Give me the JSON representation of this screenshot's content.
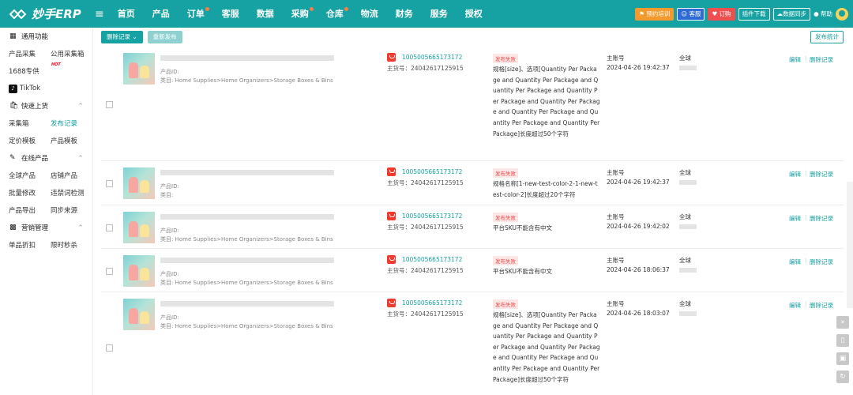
{
  "header": {
    "logo": "妙手ERP",
    "nav": [
      {
        "label": "首页",
        "dot": false
      },
      {
        "label": "产品",
        "dot": false
      },
      {
        "label": "订单",
        "dot": true
      },
      {
        "label": "客服",
        "dot": false
      },
      {
        "label": "数据",
        "dot": false
      },
      {
        "label": "采购",
        "dot": true
      },
      {
        "label": "仓库",
        "dot": true
      },
      {
        "label": "物流",
        "dot": false
      },
      {
        "label": "财务",
        "dot": false
      },
      {
        "label": "服务",
        "dot": false
      },
      {
        "label": "授权",
        "dot": false
      }
    ],
    "training": "预约培训",
    "service": "客服",
    "order_btn": "订购",
    "plugin_download": "插件下载",
    "data_sync": "数据同步",
    "help": "帮助"
  },
  "sidebar": {
    "common_title": "通用功能",
    "common_items": [
      "产品采集",
      "公用采集箱"
    ],
    "hot_item": "1688专供",
    "hot_badge": "HOT",
    "tiktok": "TikTok",
    "groups": [
      {
        "title": "快速上货",
        "rows": [
          [
            "采集箱",
            "发布记录"
          ],
          [
            "定价模板",
            "产品模板"
          ]
        ]
      },
      {
        "title": "在线产品",
        "rows": [
          [
            "全球产品",
            "店铺产品"
          ],
          [
            "批量修改",
            "违禁词检测"
          ],
          [
            "产品导出",
            "同步来源"
          ]
        ]
      },
      {
        "title": "营销管理",
        "rows": [
          [
            "单品折扣",
            "限时秒杀"
          ]
        ]
      }
    ],
    "active_item": "发布记录"
  },
  "toolbar": {
    "delete_records": "删除记录",
    "republish": "重新发布",
    "publish_stats": "发布统计"
  },
  "rows": [
    {
      "product_id_label": "产品ID:",
      "category": "类目: Home Supplies>Home Organizers>Storage Boxes & Bins",
      "item_id": "1005005665173172",
      "goods_no": "主货号：24042617125915",
      "status": "发布失败",
      "reason": "规格[size]、选项[Quantity Per Package and Quantity Per Package and Quantity Per Package and Quantity Per Package and Quantity Per Package and Quantity Per Package and Quantity Per Package and Quantity Per Package]长度超过50个字符",
      "account": "主账号",
      "time": "2024-04-26 19:42:37",
      "region": "全球",
      "edit": "编辑",
      "delete": "删除记录"
    },
    {
      "product_id_label": "产品ID:",
      "category": "类目:",
      "item_id": "1005005665173172",
      "goods_no": "主货号：24042617125915",
      "status": "发布失败",
      "reason": "规格名称[1-new-test-color-2-1-new-test-color-2]长度超过20个字符",
      "account": "主账号",
      "time": "2024-04-26 19:42:37",
      "region": "全球",
      "edit": "编辑",
      "delete": "删除记录"
    },
    {
      "product_id_label": "产品ID:",
      "category": "类目: Home Supplies>Home Organizers>Storage Boxes & Bins",
      "item_id": "1005005665173172",
      "goods_no": "主货号：24042617125915",
      "status": "发布失败",
      "reason": "平台SKU不能含有中文",
      "account": "主账号",
      "time": "2024-04-26 19:42:02",
      "region": "全球",
      "edit": "编辑",
      "delete": "删除记录"
    },
    {
      "product_id_label": "产品ID:",
      "category": "类目: Home Supplies>Home Organizers>Storage Boxes & Bins",
      "item_id": "1005005665173172",
      "goods_no": "主货号：24042617125915",
      "status": "发布失败",
      "reason": "平台SKU不能含有中文",
      "account": "主账号",
      "time": "2024-04-26 18:06:37",
      "region": "全球",
      "edit": "编辑",
      "delete": "删除记录"
    },
    {
      "product_id_label": "产品ID:",
      "category": "类目: Home Supplies>Home Organizers>Storage Boxes & Bins",
      "item_id": "1005005665173172",
      "goods_no": "主货号：24042617125915",
      "status": "发布失败",
      "reason": "规格[size]、选项[Quantity Per Package and Quantity Per Package and Quantity Per Package and Quantity Per Package and Quantity Per Package and Quantity Per Package and Quantity Per Package and Quantity Per Package]长度超过50个字符",
      "account": "主账号",
      "time": "2024-04-26 18:03:07",
      "region": "全球",
      "edit": "编辑",
      "delete": "删除记录"
    }
  ]
}
